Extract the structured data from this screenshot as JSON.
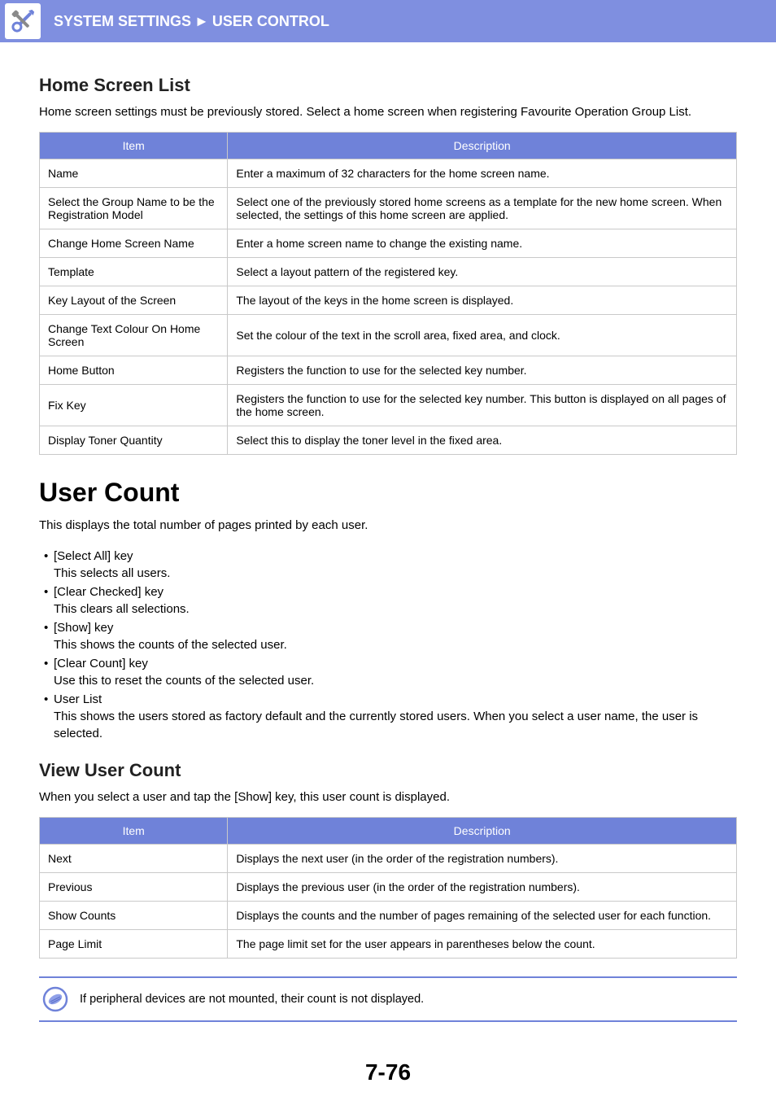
{
  "breadcrumb": {
    "part1": "SYSTEM SETTINGS",
    "part2": "USER CONTROL",
    "sep": "►"
  },
  "section1": {
    "title": "Home Screen List",
    "intro": "Home screen settings must be previously stored. Select a home screen when registering Favourite Operation Group List.",
    "table": {
      "head_item": "Item",
      "head_desc": "Description",
      "rows": [
        {
          "item": "Name",
          "desc": "Enter a maximum of 32 characters for the home screen name."
        },
        {
          "item": "Select the Group Name to be the Registration Model",
          "desc": "Select one of the previously stored home screens as a template for the new home screen. When selected, the settings of this home screen are applied."
        },
        {
          "item": "Change Home Screen Name",
          "desc": "Enter a home screen name to change the existing name."
        },
        {
          "item": "Template",
          "desc": "Select a layout pattern of the registered key."
        },
        {
          "item": "Key Layout of the Screen",
          "desc": "The layout of the keys in the home screen is displayed."
        },
        {
          "item": "Change Text Colour On Home Screen",
          "desc": "Set the colour of the text in the scroll area, fixed area, and clock."
        },
        {
          "item": "Home Button",
          "desc": "Registers the function to use for the selected key number."
        },
        {
          "item": "Fix Key",
          "desc": "Registers the function to use for the selected key number. This button is displayed on all pages of the home screen."
        },
        {
          "item": "Display Toner Quantity",
          "desc": "Select this to display the toner level in the fixed area."
        }
      ]
    }
  },
  "section2": {
    "title": "User Count",
    "intro": "This displays the total number of pages printed by each user.",
    "keys": [
      {
        "name": "[Select All] key",
        "desc": "This selects all users."
      },
      {
        "name": "[Clear Checked] key",
        "desc": "This clears all selections."
      },
      {
        "name": "[Show] key",
        "desc": "This shows the counts of the selected user."
      },
      {
        "name": "[Clear Count] key",
        "desc": "Use this to reset the counts of the selected user."
      },
      {
        "name": "User List",
        "desc": "This shows the users stored as factory default and the currently stored users. When you select a user name, the user is selected."
      }
    ]
  },
  "section3": {
    "title": "View User Count",
    "intro": "When you select a user and tap the [Show] key, this user count is displayed.",
    "table": {
      "head_item": "Item",
      "head_desc": "Description",
      "rows": [
        {
          "item": "Next",
          "desc": "Displays the next user (in the order of the registration numbers)."
        },
        {
          "item": "Previous",
          "desc": "Displays the previous user (in the order of the registration numbers)."
        },
        {
          "item": "Show Counts",
          "desc": "Displays the counts and the number of pages remaining of the selected user for each function."
        },
        {
          "item": "Page Limit",
          "desc": "The page limit set for the user appears in parentheses below the count."
        }
      ]
    }
  },
  "note": "If peripheral devices are not mounted, their count is not displayed.",
  "page_number": "7-76"
}
